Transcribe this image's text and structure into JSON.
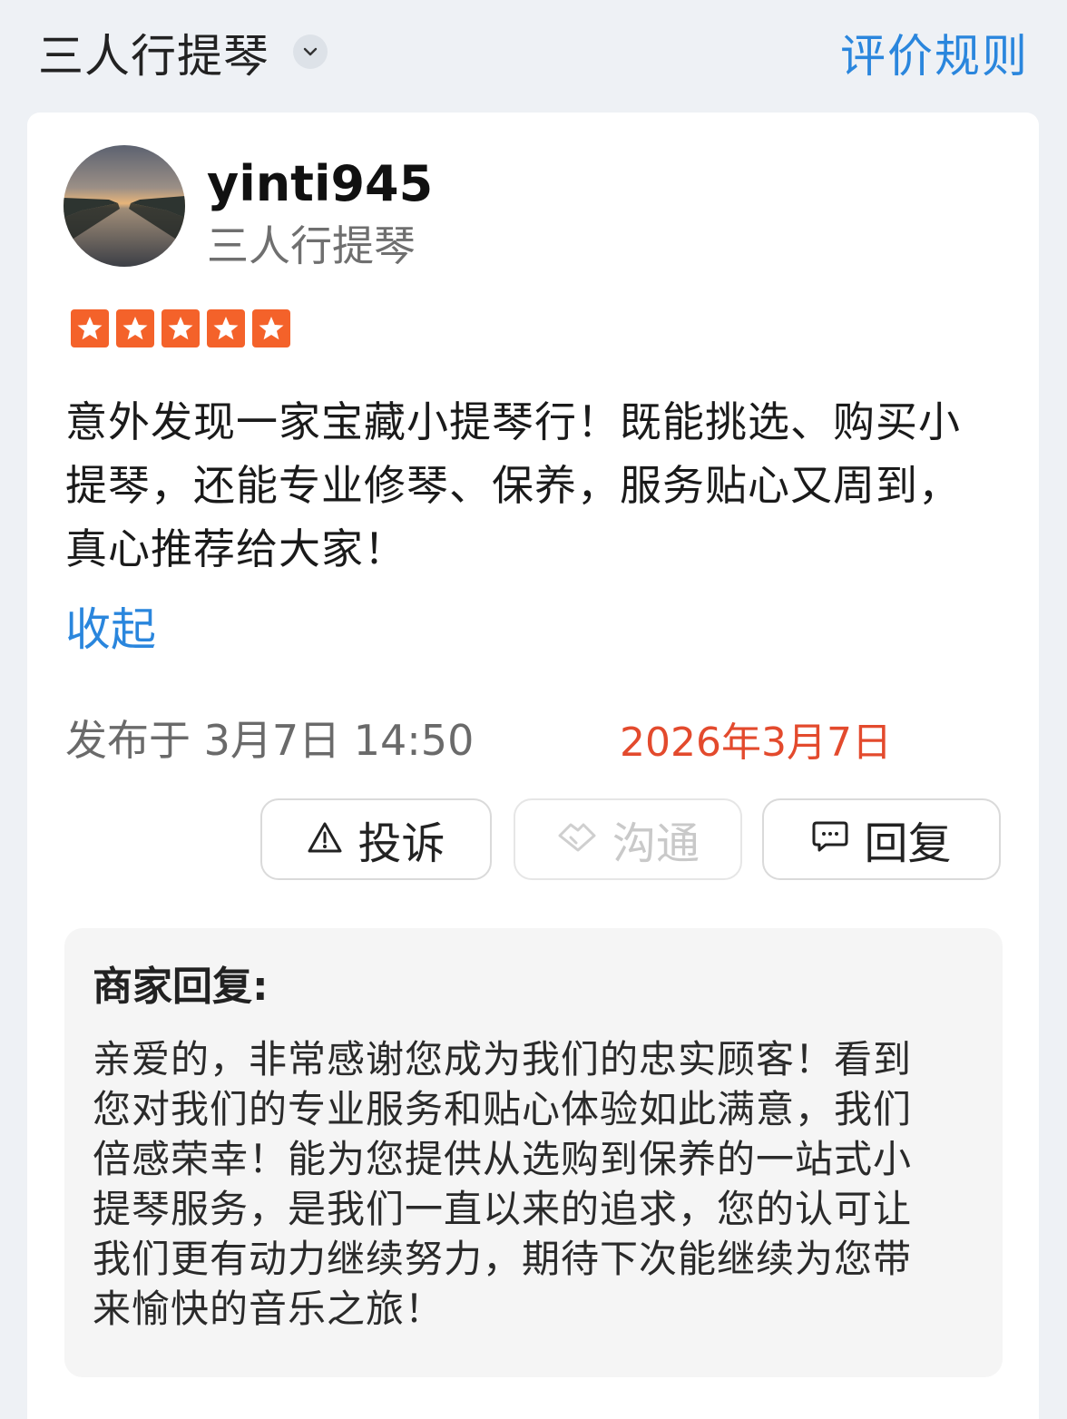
{
  "header": {
    "shop_name": "三人行提琴",
    "rules_link": "评价规则"
  },
  "review": {
    "username": "yinti945",
    "shop_tag": "三人行提琴",
    "rating_stars": 5,
    "text": "意外发现一家宝藏小提琴行！既能挑选、购买小提琴，还能专业修琴、保养，服务贴心又周到，真心推荐给大家！",
    "collapse_label": "收起",
    "posted_at": "发布于 3月7日 14:50",
    "date_note": "2026年3月7日"
  },
  "actions": {
    "complaint_label": "投诉",
    "chat_label": "沟通",
    "reply_label": "回复"
  },
  "merchant_reply": {
    "label": "商家回复:",
    "text": "亲爱的，非常感谢您成为我们的忠实顾客！看到您对我们的专业服务和贴心体验如此满意，我们倍感荣幸！能为您提供从选购到保养的一站式小提琴服务，是我们一直以来的追求，您的认可让我们更有动力继续努力，期待下次能继续为您带来愉快的音乐之旅！"
  },
  "colors": {
    "accent_blue": "#2a86dd",
    "star_orange": "#f4622a",
    "date_red": "#e34a2d"
  }
}
